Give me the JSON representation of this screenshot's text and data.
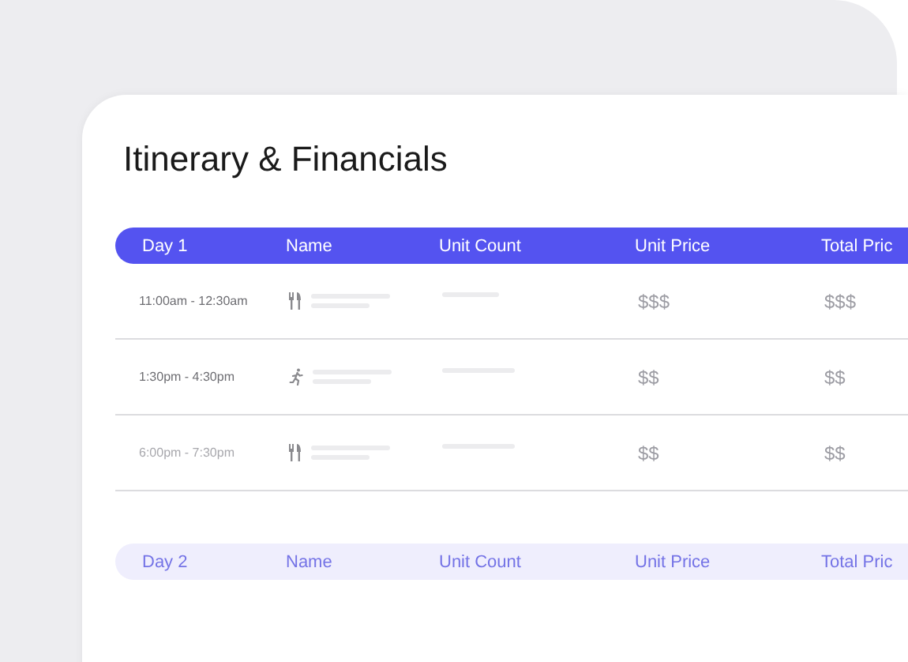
{
  "title": "Itinerary & Financials",
  "days": [
    {
      "columns": [
        "Day 1",
        "Name",
        "Unit Count",
        "Unit Price",
        "Total Pric"
      ],
      "faded": false,
      "rows": [
        {
          "time": "11:00am - 12:30am",
          "kind": "dining",
          "unit_price": "$$$",
          "total_price": "$$$",
          "faded": false
        },
        {
          "time": "1:30pm - 4:30pm",
          "kind": "activity",
          "unit_price": "$$",
          "total_price": "$$",
          "faded": false
        },
        {
          "time": "6:00pm - 7:30pm",
          "kind": "dining",
          "unit_price": "$$",
          "total_price": "$$",
          "faded": true
        }
      ]
    },
    {
      "columns": [
        "Day 2",
        "Name",
        "Unit Count",
        "Unit Price",
        "Total Pric"
      ],
      "faded": true
    }
  ]
}
